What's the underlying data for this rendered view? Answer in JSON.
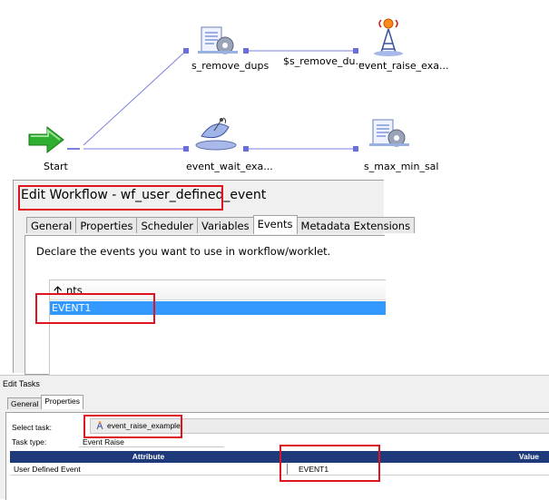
{
  "workflow_canvas": {
    "nodes": [
      {
        "id": "start",
        "label": "Start",
        "icon": "start-arrow-icon"
      },
      {
        "id": "s_remove_dups",
        "label": "s_remove_dups",
        "icon": "session-icon"
      },
      {
        "id": "event_raise",
        "label": "event_raise_exa...",
        "icon": "event-raise-icon"
      },
      {
        "id": "event_wait",
        "label": "event_wait_exa...",
        "icon": "event-wait-icon"
      },
      {
        "id": "s_max_min_sal",
        "label": "s_max_min_sal",
        "icon": "session-icon"
      }
    ],
    "link_condition_label": "$s_remove_du..."
  },
  "edit_workflow": {
    "title": "Edit Workflow - wf_user_defined_event",
    "tabs": [
      "General",
      "Properties",
      "Scheduler",
      "Variables",
      "Events",
      "Metadata Extensions"
    ],
    "active_tab": "Events",
    "description": "Declare the events you want to use in workflow/worklet.",
    "events_column_header": "nts",
    "events": [
      "EVENT1"
    ],
    "selected_row_color": "#3399ff"
  },
  "edit_tasks": {
    "title": "Edit Tasks",
    "tabs": [
      "General",
      "Properties"
    ],
    "active_tab": "Properties",
    "select_task_label": "Select task:",
    "select_task_value": "event_raise_example",
    "task_type_label": "Task type:",
    "task_type_value": "Event Raise",
    "table_headers": {
      "attribute": "Attribute",
      "value": "Value"
    },
    "rows": [
      {
        "attribute": "User Defined Event",
        "value": "EVENT1"
      }
    ],
    "header_color": "#1e3a7a"
  },
  "highlight_color": "#e0141e"
}
